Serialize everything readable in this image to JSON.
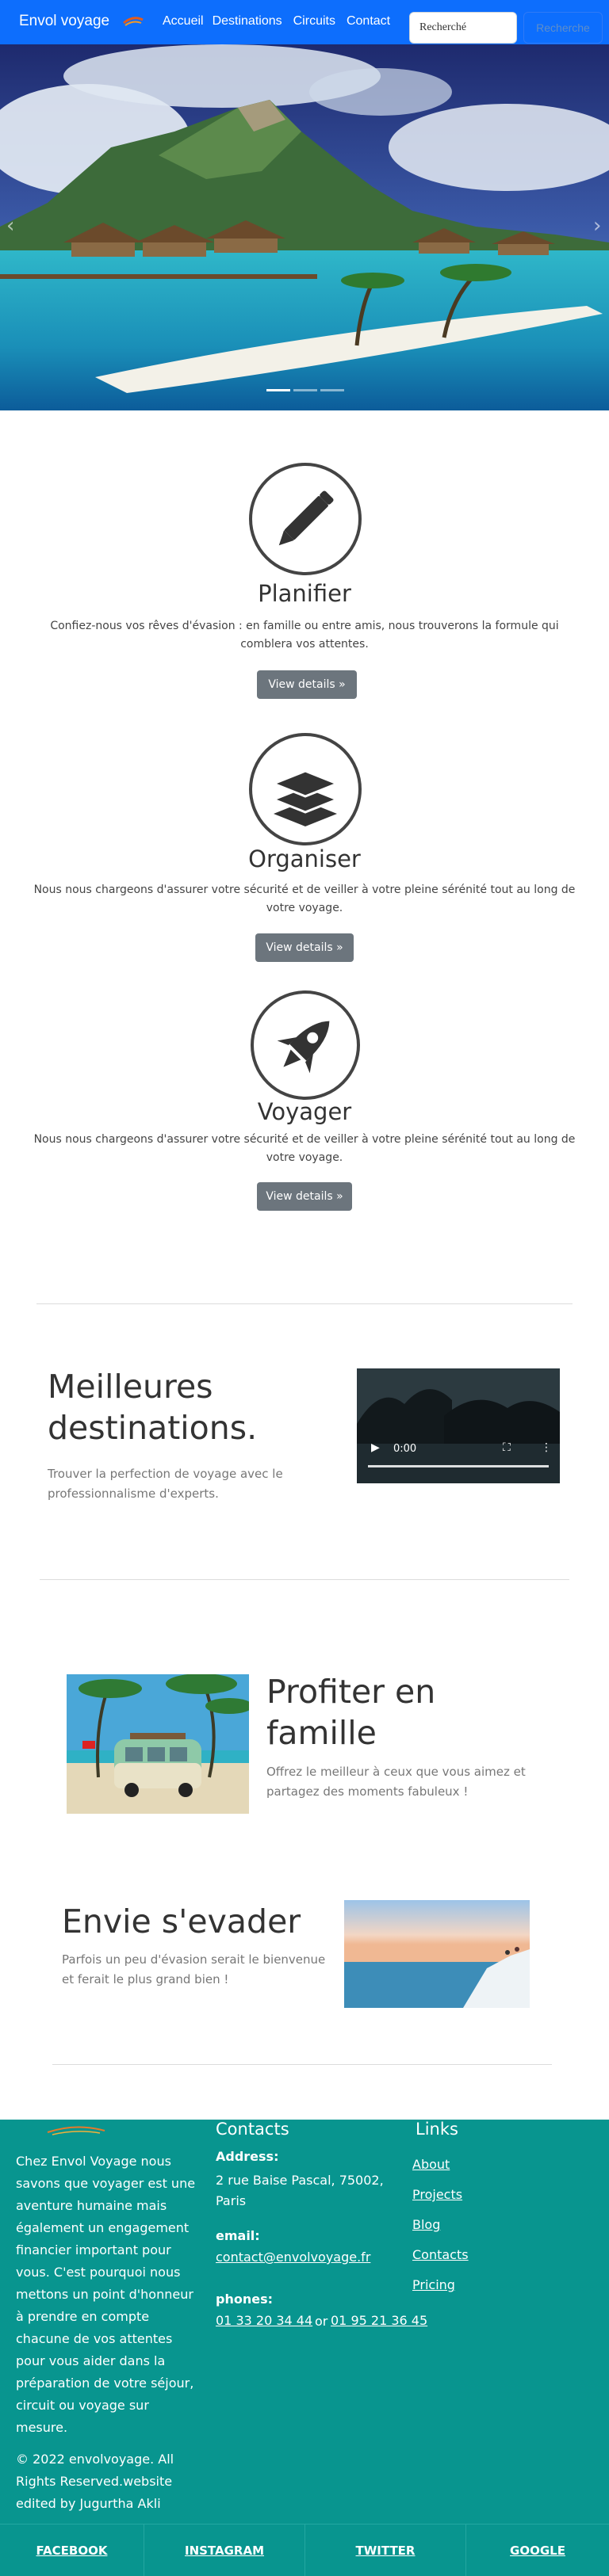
{
  "navbar": {
    "brand": "Envol voyage",
    "links": [
      "Accueil",
      "Destinations",
      "Circuits",
      "Contact"
    ],
    "search_value": "Recherché",
    "search_button": "Recherche"
  },
  "features": [
    {
      "title": "Planifier",
      "description": "Confiez-nous vos rêves d'évasion : en famille ou entre amis, nous trouverons la formule qui comblera vos attentes.",
      "button": "View details »",
      "icon": "pen-icon"
    },
    {
      "title": "Organiser",
      "description": "Nous nous chargeons d'assurer votre sécurité et de veiller à votre pleine sérénité tout au long de votre voyage.",
      "button": "View details »",
      "icon": "layers-icon"
    },
    {
      "title": "Voyager",
      "description": "Nous nous chargeons d'assurer votre sécurité et de veiller à votre pleine sérénité tout au long de votre voyage.",
      "button": "View details »",
      "icon": "rocket-icon"
    }
  ],
  "featurettes": [
    {
      "title": "Meilleures destinations.",
      "text": "Trouver la perfection de voyage avec le professionnalisme d'experts."
    },
    {
      "title": "Profiter en famille",
      "text": "Offrez le meilleur à ceux que vous aimez et partagez des moments fabuleux !"
    },
    {
      "title": "Envie s'evader",
      "text": "Parfois un peu d'évasion serait le bienvenue et ferait le plus grand bien !"
    }
  ],
  "video": {
    "time": "0:00"
  },
  "footer": {
    "about": "Chez Envol Voyage nous savons que voyager est une aventure humaine mais également un engagement financier important pour vous. C'est pourquoi nous mettons un point d'honneur à prendre en compte chacune de vos attentes pour vous aider dans la préparation de votre séjour, circuit ou voyage sur mesure.",
    "copyright": "©  2022 envolvoyage. All Rights Reserved.website edited by Jugurtha Akli",
    "contacts_heading": "Contacts",
    "address_label": "Address:",
    "address": "2 rue Baise Pascal, 75002, Paris",
    "email_label": "email:",
    "email": "contact@envolvoyage.fr",
    "phones_label": "phones:",
    "phone1": "01 33 20 34 44",
    "phone_sep": "or",
    "phone2": "01 95 21 36 45",
    "links_heading": "Links",
    "links": [
      "About",
      "Projects",
      "Blog",
      "Contacts",
      "Pricing"
    ],
    "social": [
      "FACEBOOK",
      "INSTAGRAM",
      "TWITTER",
      "GOOGLE"
    ]
  },
  "colors": {
    "primary": "#0d6efd",
    "footer": "#08958f",
    "button": "#6c757d"
  }
}
